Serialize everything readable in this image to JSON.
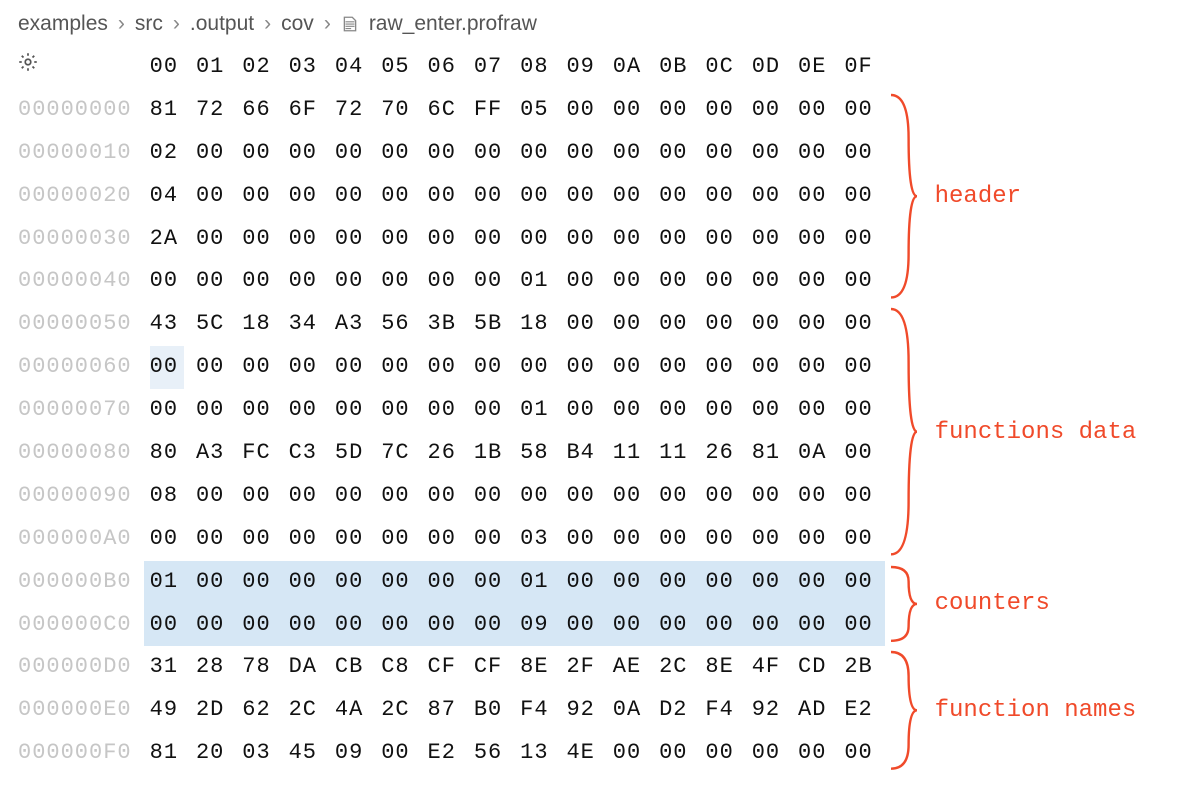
{
  "breadcrumb": {
    "items": [
      "examples",
      "src",
      ".output",
      "cov",
      "raw_enter.profraw"
    ]
  },
  "hex": {
    "header_bytes": [
      "00",
      "01",
      "02",
      "03",
      "04",
      "05",
      "06",
      "07",
      "08",
      "09",
      "0A",
      "0B",
      "0C",
      "0D",
      "0E",
      "0F"
    ],
    "rows": [
      {
        "offset": "00000000",
        "bytes": [
          "81",
          "72",
          "66",
          "6F",
          "72",
          "70",
          "6C",
          "FF",
          "05",
          "00",
          "00",
          "00",
          "00",
          "00",
          "00",
          "00"
        ],
        "section": "header"
      },
      {
        "offset": "00000010",
        "bytes": [
          "02",
          "00",
          "00",
          "00",
          "00",
          "00",
          "00",
          "00",
          "00",
          "00",
          "00",
          "00",
          "00",
          "00",
          "00",
          "00"
        ],
        "section": "header"
      },
      {
        "offset": "00000020",
        "bytes": [
          "04",
          "00",
          "00",
          "00",
          "00",
          "00",
          "00",
          "00",
          "00",
          "00",
          "00",
          "00",
          "00",
          "00",
          "00",
          "00"
        ],
        "section": "header"
      },
      {
        "offset": "00000030",
        "bytes": [
          "2A",
          "00",
          "00",
          "00",
          "00",
          "00",
          "00",
          "00",
          "00",
          "00",
          "00",
          "00",
          "00",
          "00",
          "00",
          "00"
        ],
        "section": "header"
      },
      {
        "offset": "00000040",
        "bytes": [
          "00",
          "00",
          "00",
          "00",
          "00",
          "00",
          "00",
          "00",
          "01",
          "00",
          "00",
          "00",
          "00",
          "00",
          "00",
          "00"
        ],
        "section": "header"
      },
      {
        "offset": "00000050",
        "bytes": [
          "43",
          "5C",
          "18",
          "34",
          "A3",
          "56",
          "3B",
          "5B",
          "18",
          "00",
          "00",
          "00",
          "00",
          "00",
          "00",
          "00"
        ],
        "section": "functions_data"
      },
      {
        "offset": "00000060",
        "bytes": [
          "00",
          "00",
          "00",
          "00",
          "00",
          "00",
          "00",
          "00",
          "00",
          "00",
          "00",
          "00",
          "00",
          "00",
          "00",
          "00"
        ],
        "section": "functions_data",
        "cell_hl": [
          0
        ]
      },
      {
        "offset": "00000070",
        "bytes": [
          "00",
          "00",
          "00",
          "00",
          "00",
          "00",
          "00",
          "00",
          "01",
          "00",
          "00",
          "00",
          "00",
          "00",
          "00",
          "00"
        ],
        "section": "functions_data"
      },
      {
        "offset": "00000080",
        "bytes": [
          "80",
          "A3",
          "FC",
          "C3",
          "5D",
          "7C",
          "26",
          "1B",
          "58",
          "B4",
          "11",
          "11",
          "26",
          "81",
          "0A",
          "00"
        ],
        "section": "functions_data"
      },
      {
        "offset": "00000090",
        "bytes": [
          "08",
          "00",
          "00",
          "00",
          "00",
          "00",
          "00",
          "00",
          "00",
          "00",
          "00",
          "00",
          "00",
          "00",
          "00",
          "00"
        ],
        "section": "functions_data"
      },
      {
        "offset": "000000A0",
        "bytes": [
          "00",
          "00",
          "00",
          "00",
          "00",
          "00",
          "00",
          "00",
          "03",
          "00",
          "00",
          "00",
          "00",
          "00",
          "00",
          "00"
        ],
        "section": "functions_data"
      },
      {
        "offset": "000000B0",
        "bytes": [
          "01",
          "00",
          "00",
          "00",
          "00",
          "00",
          "00",
          "00",
          "01",
          "00",
          "00",
          "00",
          "00",
          "00",
          "00",
          "00"
        ],
        "section": "counters",
        "hl": true
      },
      {
        "offset": "000000C0",
        "bytes": [
          "00",
          "00",
          "00",
          "00",
          "00",
          "00",
          "00",
          "00",
          "09",
          "00",
          "00",
          "00",
          "00",
          "00",
          "00",
          "00"
        ],
        "section": "counters",
        "hl": true
      },
      {
        "offset": "000000D0",
        "bytes": [
          "31",
          "28",
          "78",
          "DA",
          "CB",
          "C8",
          "CF",
          "CF",
          "8E",
          "2F",
          "AE",
          "2C",
          "8E",
          "4F",
          "CD",
          "2B"
        ],
        "section": "function_names"
      },
      {
        "offset": "000000E0",
        "bytes": [
          "49",
          "2D",
          "62",
          "2C",
          "4A",
          "2C",
          "87",
          "B0",
          "F4",
          "92",
          "0A",
          "D2",
          "F4",
          "92",
          "AD",
          "E2"
        ],
        "section": "function_names"
      },
      {
        "offset": "000000F0",
        "bytes": [
          "81",
          "20",
          "03",
          "45",
          "09",
          "00",
          "E2",
          "56",
          "13",
          "4E",
          "00",
          "00",
          "00",
          "00",
          "00",
          "00"
        ],
        "section": "function_names"
      }
    ]
  },
  "annotations": {
    "sections": [
      {
        "id": "header",
        "label": "header"
      },
      {
        "id": "functions_data",
        "label": "functions data"
      },
      {
        "id": "counters",
        "label": "counters"
      },
      {
        "id": "function_names",
        "label": "function names"
      }
    ]
  }
}
